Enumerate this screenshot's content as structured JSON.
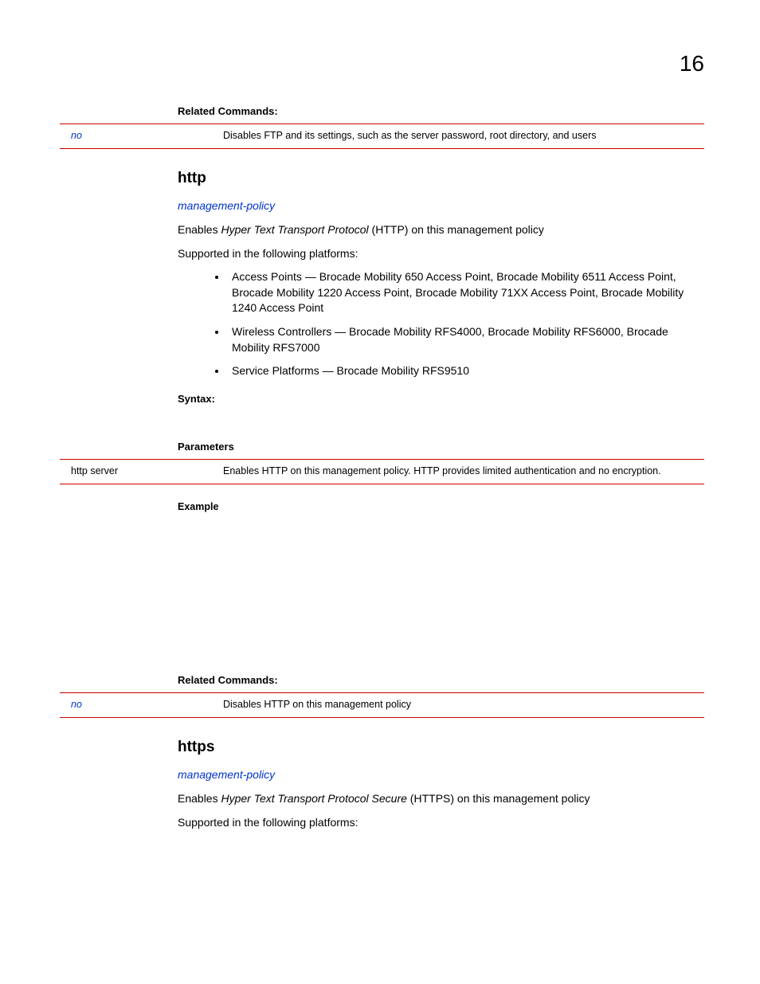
{
  "page": {
    "number": "16"
  },
  "sec0": {
    "related_heading": "Related Commands:",
    "row": {
      "key": "no",
      "desc": "Disables FTP and its settings, such as the server password, root directory, and users"
    }
  },
  "http": {
    "title": "http",
    "parent": "management-policy",
    "desc_pre": "Enables ",
    "desc_em": "Hyper Text Transport Protocol",
    "desc_post": " (HTTP) on this management policy",
    "platforms_intro": "Supported in the following platforms:",
    "bullets": [
      "Access Points — Brocade Mobility 650 Access Point, Brocade Mobility 6511 Access Point, Brocade Mobility 1220 Access Point, Brocade Mobility 71XX Access Point, Brocade Mobility 1240 Access Point",
      "Wireless Controllers — Brocade Mobility RFS4000, Brocade Mobility RFS6000, Brocade Mobility RFS7000",
      "Service Platforms — Brocade Mobility RFS9510"
    ],
    "syntax_heading": "Syntax:",
    "params_heading": "Parameters",
    "param_row": {
      "key": "http server",
      "desc": "Enables HTTP on this management policy. HTTP provides limited authentication and no encryption."
    },
    "example_heading": "Example",
    "related_heading": "Related Commands:",
    "related_row": {
      "key": "no",
      "desc": "Disables HTTP on this management policy"
    }
  },
  "https": {
    "title": "https",
    "parent": "management-policy",
    "desc_pre": "Enables ",
    "desc_em": "Hyper Text Transport Protocol Secure",
    "desc_post": " (HTTPS) on this management policy",
    "platforms_intro": "Supported in the following platforms:"
  }
}
